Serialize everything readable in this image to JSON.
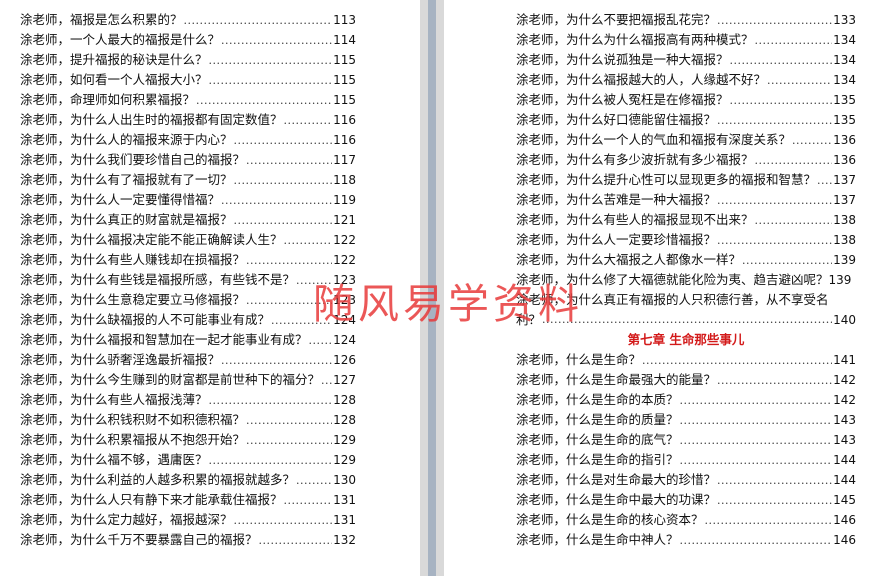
{
  "left_page": {
    "entries": [
      {
        "text": "涂老师，福报是怎么积累的？",
        "page": "113"
      },
      {
        "text": "涂老师，一个人最大的福报是什么？",
        "page": "114"
      },
      {
        "text": "涂老师，提升福报的秘诀是什么？",
        "page": "115"
      },
      {
        "text": "涂老师，如何看一个人福报大小？",
        "page": "115"
      },
      {
        "text": "涂老师，命理师如何积累福报？",
        "page": "115"
      },
      {
        "text": "涂老师，为什么人出生时的福报都有固定数值？",
        "page": "116"
      },
      {
        "text": "涂老师，为什么人的福报来源于内心？",
        "page": "116"
      },
      {
        "text": "涂老师，为什么我们要珍惜自己的福报？",
        "page": "117"
      },
      {
        "text": "涂老师，为什么有了福报就有了一切？",
        "page": "118"
      },
      {
        "text": "涂老师，为什么人一定要懂得惜福？",
        "page": "119"
      },
      {
        "text": "涂老师，为什么真正的财富就是福报？",
        "page": "121"
      },
      {
        "text": "涂老师，为什么福报决定能不能正确解读人生？",
        "page": "122"
      },
      {
        "text": "涂老师，为什么有些人赚钱却在损福报？",
        "page": "122"
      },
      {
        "text": "涂老师，为什么有些钱是福报所感，有些钱不是？",
        "page": "123"
      },
      {
        "text": "涂老师，为什么生意稳定要立马修福报？",
        "page": "123"
      },
      {
        "text": "涂老师，为什么缺福报的人不可能事业有成？",
        "page": "124"
      },
      {
        "text": "涂老师，为什么福报和智慧加在一起才能事业有成？",
        "page": "124"
      },
      {
        "text": "涂老师，为什么骄奢淫逸最折福报？",
        "page": "126"
      },
      {
        "text": "涂老师，为什么今生赚到的财富都是前世种下的福分？",
        "page": "127"
      },
      {
        "text": "涂老师，为什么有些人福报浅薄？",
        "page": "128"
      },
      {
        "text": "涂老师，为什么积钱积财不如积德积福？",
        "page": "128"
      },
      {
        "text": "涂老师，为什么积累福报从不抱怨开始？",
        "page": "129"
      },
      {
        "text": "涂老师，为什么福不够，遇庸医？",
        "page": "129"
      },
      {
        "text": "涂老师，为什么利益的人越多积累的福报就越多？",
        "page": "130"
      },
      {
        "text": "涂老师，为什么人只有静下来才能承载住福报？",
        "page": "131"
      },
      {
        "text": "涂老师，为什么定力越好，福报越深？",
        "page": "131"
      },
      {
        "text": "涂老师，为什么千万不要暴露自己的福报？",
        "page": "132"
      }
    ]
  },
  "right_page": {
    "entries_top": [
      {
        "text": "涂老师，为什么不要把福报乱花完？",
        "page": "133"
      },
      {
        "text": "涂老师，为什么为什么福报高有两种模式？",
        "page": "134"
      },
      {
        "text": "涂老师，为什么说孤独是一种大福报？",
        "page": "134"
      },
      {
        "text": "涂老师，为什么福报越大的人，人缘越不好？",
        "page": "134"
      },
      {
        "text": "涂老师，为什么被人冤枉是在修福报？",
        "page": "135"
      },
      {
        "text": "涂老师，为什么好口德能留住福报？",
        "page": "135"
      },
      {
        "text": "涂老师，为什么一个人的气血和福报有深度关系？",
        "page": "136"
      },
      {
        "text": "涂老师，为什么有多少波折就有多少福报？",
        "page": "136"
      },
      {
        "text": "涂老师，为什么提升心性可以显现更多的福报和智慧？",
        "page": "137"
      },
      {
        "text": "涂老师，为什么苦难是一种大福报？",
        "page": "137"
      },
      {
        "text": "涂老师，为什么有些人的福报显现不出来？",
        "page": "138"
      },
      {
        "text": "涂老师，为什么人一定要珍惜福报？",
        "page": "138"
      },
      {
        "text": "涂老师，为什么大福报之人都像水一样？",
        "page": "139"
      }
    ],
    "entry_tight": {
      "text": "涂老师，为什么修了大福德就能化险为夷、趋吉避凶呢？",
      "page": "139"
    },
    "entry_wrapped": {
      "line1": "涂老师，为什么真正有福报的人只积德行善，从不享受名",
      "line2": "利？",
      "page": "140"
    },
    "chapter_title": "第七章 生命那些事儿",
    "entries_bottom": [
      {
        "text": "涂老师，什么是生命？",
        "page": "141"
      },
      {
        "text": "涂老师，什么是生命最强大的能量？",
        "page": "142"
      },
      {
        "text": "涂老师，什么是生命的本质？",
        "page": "142"
      },
      {
        "text": "涂老师，什么是生命的质量？",
        "page": "143"
      },
      {
        "text": "涂老师，什么是生命的底气？",
        "page": "143"
      },
      {
        "text": "涂老师，什么是生命的指引？",
        "page": "144"
      },
      {
        "text": "涂老师，什么是对生命最大的珍惜？",
        "page": "144"
      },
      {
        "text": "涂老师，什么是生命中最大的功课？",
        "page": "145"
      },
      {
        "text": "涂老师，什么是生命的核心资本？",
        "page": "146"
      },
      {
        "text": "涂老师，什么是生命中神人？",
        "page": "146"
      }
    ]
  },
  "watermark": "随风易学资料",
  "colors": {
    "chapter": "#d31a1a",
    "watermark": "#e83a3a",
    "gutter": "#a7b3c2"
  }
}
